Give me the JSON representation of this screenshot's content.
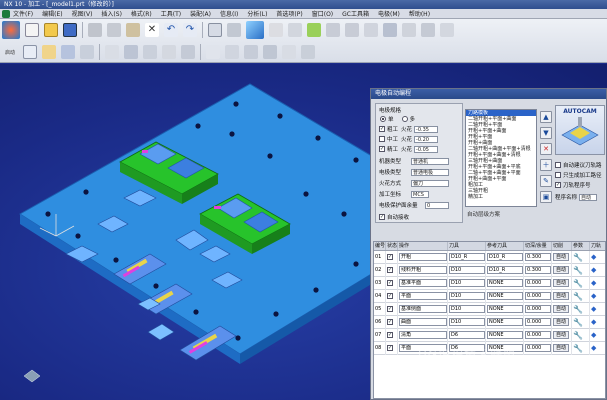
{
  "window": {
    "title": "NX 10 - 加工 - [_model1.prt（修改的）]"
  },
  "menubar": {
    "items": [
      "文件(F)",
      "编辑(E)",
      "视图(V)",
      "插入(S)",
      "格式(R)",
      "工具(T)",
      "装配(A)",
      "信息(I)",
      "分析(L)",
      "首选项(P)",
      "窗口(O)",
      "GC工具箱",
      "电极(M)",
      "帮助(H)"
    ]
  },
  "toolbar": {
    "labels": [
      "启动",
      "新建",
      "打开",
      "保存",
      "剪切",
      "复制",
      "粘贴",
      "删除",
      "撤销",
      "重做"
    ]
  },
  "dialog": {
    "title": "电极自动编程",
    "group1_title": "电极规格",
    "radio_options": [
      "单",
      "多"
    ],
    "rough": {
      "label": "粗工",
      "gap_label": "火花",
      "gap_value": "-0.35"
    },
    "mid": {
      "label": "中工",
      "gap_label": "火花",
      "gap_value": "-0.20"
    },
    "fine": {
      "label": "精工",
      "gap_label": "火花",
      "gap_value": "-0.05"
    },
    "fields": [
      {
        "label": "机器类型",
        "value": "普通机"
      },
      {
        "label": "电极类型",
        "value": "普通电极"
      },
      {
        "label": "火花方式",
        "value": "偏刀"
      },
      {
        "label": "加工坐标",
        "value": "MCS"
      },
      {
        "label": "电极保护面余量",
        "value": "0"
      }
    ],
    "auto_checkbox": "自动接收",
    "template_items": [
      "刀路模板",
      "二轴开粗+平面+曲面",
      "二轴开粗+平面",
      "开粗+平面+曲面",
      "开粗+平面",
      "开粗+曲面",
      "二轴开粗+曲面+平面+清根",
      "开粗+平面+曲面+清根",
      "三轴开粗+曲面",
      "开粗+平面+曲面+平底",
      "二轴+平面+曲面+平面",
      "开粗+曲面+平面",
      "粗加工",
      "三轴开粗",
      "精加工"
    ],
    "template_footer": "自动层级方案",
    "autocam_label": "AUTOCAM",
    "right_options": [
      "自动建议刀轨路",
      "只生成加工路径",
      "刀轨程序号"
    ],
    "process_label": "程序名称",
    "process_value": "自动",
    "table": {
      "headers": [
        "编号",
        "状态",
        "操作",
        "刀具",
        "参考刀具",
        "切深/余量",
        "切削",
        "参数",
        "刀轨"
      ],
      "rows": [
        {
          "no": "01",
          "op": "开粗",
          "tool": "D10_R",
          "ref": "D10_R",
          "depth": "0.300",
          "cut": "自动"
        },
        {
          "no": "02",
          "op": "残料开粗",
          "tool": "D10",
          "ref": "D10_R",
          "depth": "0.300",
          "cut": "自动"
        },
        {
          "no": "03",
          "op": "基准平面",
          "tool": "D10",
          "ref": "NONE",
          "depth": "0.000",
          "cut": "自动"
        },
        {
          "no": "04",
          "op": "平面",
          "tool": "D10",
          "ref": "NONE",
          "depth": "0.000",
          "cut": "自动"
        },
        {
          "no": "05",
          "op": "基准侧面",
          "tool": "D10",
          "ref": "NONE",
          "depth": "0.000",
          "cut": "自动"
        },
        {
          "no": "06",
          "op": "曲面",
          "tool": "D10",
          "ref": "NONE",
          "depth": "0.000",
          "cut": "自动"
        },
        {
          "no": "07",
          "op": "清角",
          "tool": "D6",
          "ref": "NONE",
          "depth": "0.000",
          "cut": "自动"
        },
        {
          "no": "08",
          "op": "平面",
          "tool": "D6",
          "ref": "NONE",
          "depth": "0.000",
          "cut": "自动"
        }
      ]
    }
  },
  "watermark": "UG编程技术联盟",
  "colors": {
    "viewport": "#1c2c8c",
    "plate": "#3a9ae6",
    "electrode": "#2fd22f",
    "accent": "#2a63c8"
  }
}
